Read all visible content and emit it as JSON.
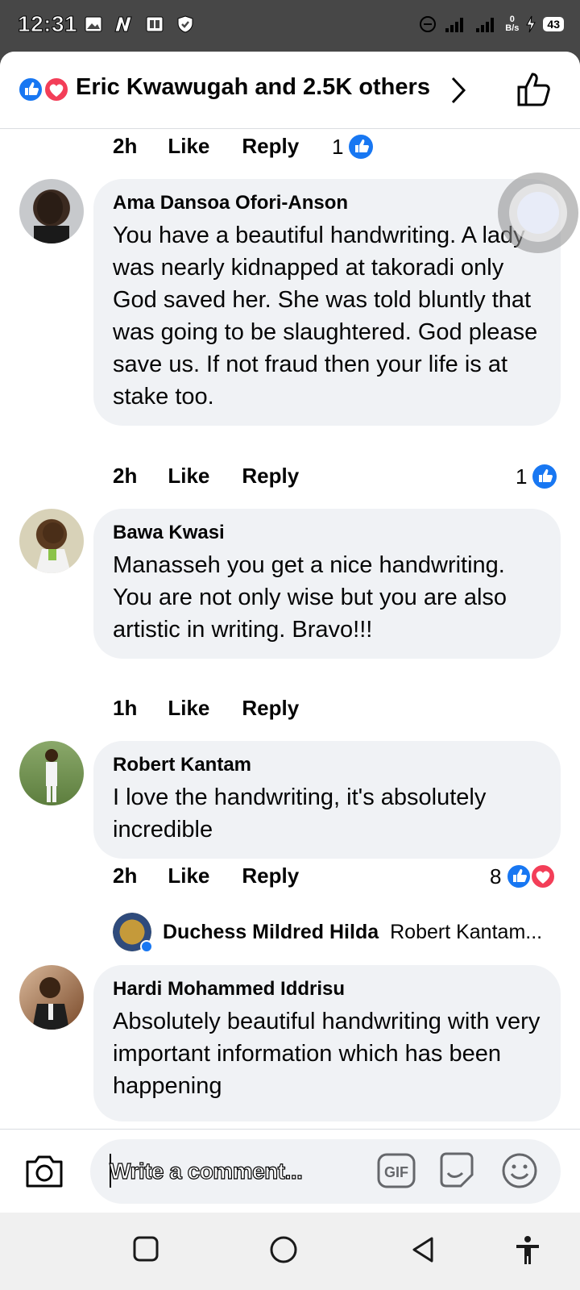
{
  "status_bar": {
    "time": "12:31",
    "battery": "43",
    "net_speed_value": "0",
    "net_speed_unit": "B/s",
    "network": "3G"
  },
  "header": {
    "reactions_text": "Eric Kwawugah and 2.5K others",
    "icons": [
      "like-reaction-icon",
      "love-reaction-icon",
      "chevron-right-icon",
      "thumbs-up-icon"
    ]
  },
  "comments": [
    {
      "meta": {
        "time": "2h",
        "like": "Like",
        "reply": "Reply"
      },
      "reaction_count": "1"
    },
    {
      "author": "Ama Dansoa Ofori-Anson",
      "text": "You have a beautiful handwriting. A lady was nearly kidnapped at takoradi only God saved her. She was told bluntly that was going to be slaughtered. God please save us. If not fraud then your life is at stake too.",
      "meta": {
        "time": "2h",
        "like": "Like",
        "reply": "Reply"
      },
      "reaction_count": "1"
    },
    {
      "author": "Bawa Kwasi",
      "text": "Manasseh you get a nice handwriting. You are not only wise but you are also artistic in writing. Bravo!!!",
      "meta": {
        "time": "1h",
        "like": "Like",
        "reply": "Reply"
      }
    },
    {
      "author": "Robert Kantam",
      "text": "I love the handwriting, it's absolutely incredible",
      "meta": {
        "time": "2h",
        "like": "Like",
        "reply": "Reply"
      },
      "reaction_count": "8",
      "reply_preview": {
        "author": "Duchess Mildred Hilda",
        "text": "Robert Kantam..."
      }
    },
    {
      "author": "Hardi Mohammed Iddrisu",
      "text": "Absolutely beautiful handwriting with very important information which has been happening"
    }
  ],
  "composer": {
    "placeholder": "Write a comment...",
    "gif_label": "GIF"
  },
  "colors": {
    "accent_blue": "#1877f2",
    "love_red": "#f33e58",
    "bubble_bg": "#f0f2f5",
    "status_bar_bg": "#474747"
  }
}
